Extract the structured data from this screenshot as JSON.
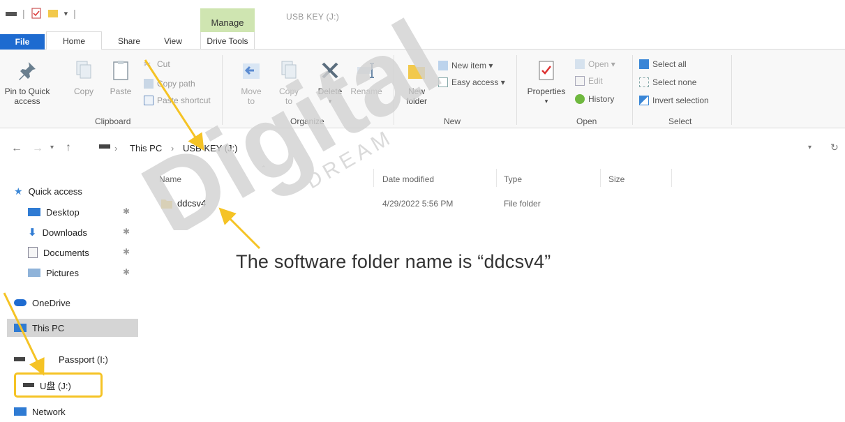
{
  "titlebar": {
    "manage_label": "Manage",
    "window_title": "USB KEY (J:)"
  },
  "tabs": {
    "file": "File",
    "home": "Home",
    "share": "Share",
    "view": "View",
    "drive_tools": "Drive Tools"
  },
  "ribbon": {
    "clipboard": {
      "pin_line1": "Pin to Quick",
      "pin_line2": "access",
      "copy": "Copy",
      "paste": "Paste",
      "cut": "Cut",
      "copy_path": "Copy path",
      "paste_shortcut": "Paste shortcut",
      "group": "Clipboard"
    },
    "organize": {
      "move_line1": "Move",
      "move_line2": "to",
      "copy_line1": "Copy",
      "copy_line2": "to",
      "delete": "Delete",
      "rename": "Rename",
      "group": "Organize"
    },
    "new": {
      "folder_line1": "New",
      "folder_line2": "folder",
      "new_item": "New item ▾",
      "easy_access": "Easy access ▾",
      "group": "New"
    },
    "open": {
      "properties": "Properties",
      "open": "Open ▾",
      "edit": "Edit",
      "history": "History",
      "group": "Open"
    },
    "select": {
      "select_all": "Select all",
      "select_none": "Select none",
      "invert": "Invert selection",
      "group": "Select"
    }
  },
  "address": {
    "this_pc": "This PC",
    "separator": "›",
    "drive": "USB KEY (J:)"
  },
  "nav": {
    "quick_access": "Quick access",
    "desktop": "Desktop",
    "downloads": "Downloads",
    "documents": "Documents",
    "pictures": "Pictures",
    "onedrive": "OneDrive",
    "this_pc": "This PC",
    "passport": "Passport (I:)",
    "usb": "U盘 (J:)",
    "network": "Network"
  },
  "columns": {
    "name": "Name",
    "date": "Date modified",
    "type": "Type",
    "size": "Size"
  },
  "files": [
    {
      "name": "ddcsv4",
      "date": "4/29/2022 5:56 PM",
      "type": "File folder",
      "size": ""
    }
  ],
  "annotation": "The software folder name is “ddcsv4”",
  "watermark": {
    "main": "Digital",
    "sub": "DREAM"
  },
  "colors": {
    "file_tab": "#1e6bd0",
    "manage_tab": "#cfe5b1",
    "highlight_arrow": "#f5c325",
    "folder": "#f2c94c",
    "watermark": "#d8d8d8"
  }
}
